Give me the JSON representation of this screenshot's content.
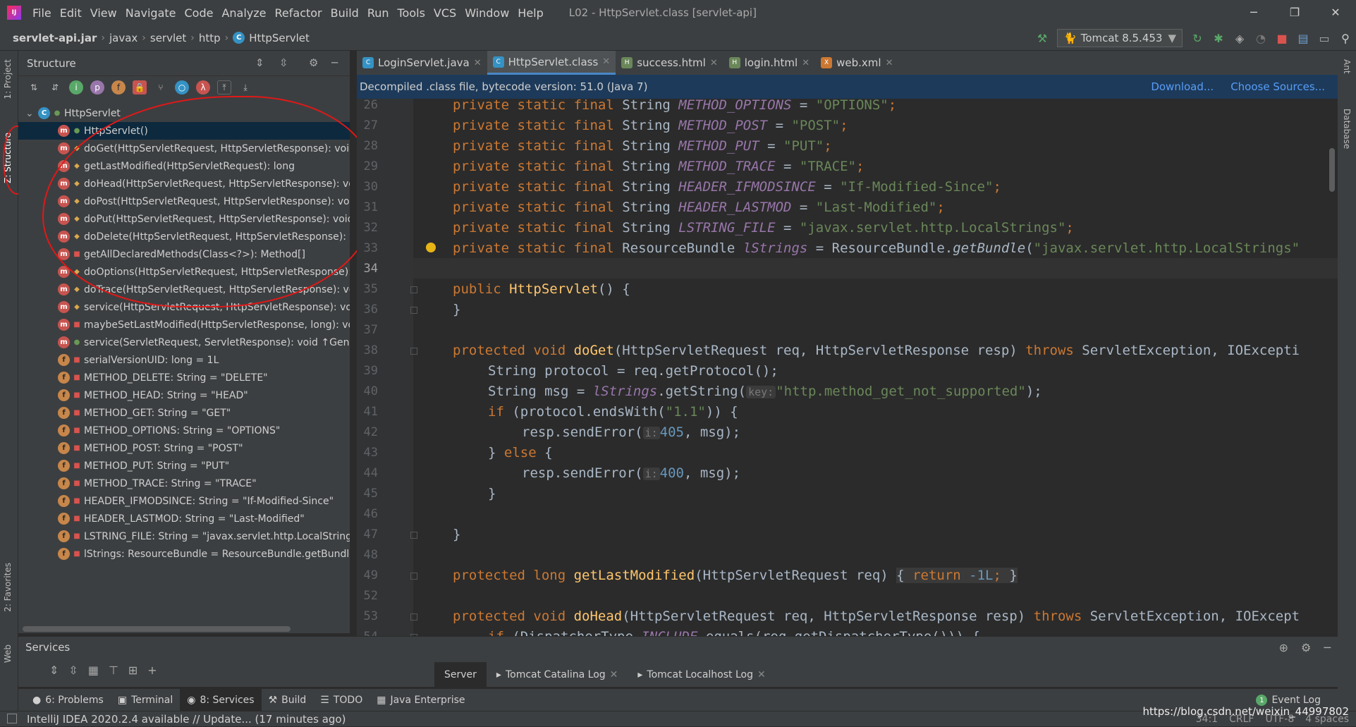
{
  "app": {
    "title": "L02 - HttpServlet.class [servlet-api]"
  },
  "menu": [
    "File",
    "Edit",
    "View",
    "Navigate",
    "Code",
    "Analyze",
    "Refactor",
    "Build",
    "Run",
    "Tools",
    "VCS",
    "Window",
    "Help"
  ],
  "window_controls": {
    "minimize": "─",
    "maximize": "❐",
    "close": "✕"
  },
  "breadcrumbs": [
    "servlet-api.jar",
    "javax",
    "servlet",
    "http",
    "HttpServlet"
  ],
  "run_config": "Tomcat 8.5.453",
  "left_strip": {
    "project": "1: Project",
    "structure": "Z: Structure",
    "favorites": "2: Favorites",
    "web": "Web"
  },
  "right_strip": {
    "ant": "Ant",
    "database": "Database"
  },
  "structure": {
    "title": "Structure",
    "root": "HttpServlet",
    "items": [
      {
        "kind": "m",
        "vis": "pub",
        "label": "HttpServlet()"
      },
      {
        "kind": "m",
        "vis": "prot",
        "label": "doGet(HttpServletRequest, HttpServletResponse): void ↑Gen"
      },
      {
        "kind": "m",
        "vis": "prot",
        "label": "getLastModified(HttpServletRequest): long"
      },
      {
        "kind": "m",
        "vis": "prot",
        "label": "doHead(HttpServletRequest, HttpServletResponse): void"
      },
      {
        "kind": "m",
        "vis": "prot",
        "label": "doPost(HttpServletRequest, HttpServletResponse): void"
      },
      {
        "kind": "m",
        "vis": "prot",
        "label": "doPut(HttpServletRequest, HttpServletResponse): void"
      },
      {
        "kind": "m",
        "vis": "prot",
        "label": "doDelete(HttpServletRequest, HttpServletResponse): void"
      },
      {
        "kind": "m",
        "vis": "priv",
        "label": "getAllDeclaredMethods(Class<?>): Method[]"
      },
      {
        "kind": "m",
        "vis": "prot",
        "label": "doOptions(HttpServletRequest, HttpServletResponse): void"
      },
      {
        "kind": "m",
        "vis": "prot",
        "label": "doTrace(HttpServletRequest, HttpServletResponse): void"
      },
      {
        "kind": "m",
        "vis": "prot",
        "label": "service(HttpServletRequest, HttpServletResponse): void"
      },
      {
        "kind": "m",
        "vis": "priv",
        "label": "maybeSetLastModified(HttpServletResponse, long): void"
      },
      {
        "kind": "m",
        "vis": "pub",
        "label": "service(ServletRequest, ServletResponse): void ↑Gen"
      },
      {
        "kind": "f",
        "vis": "priv",
        "label": "serialVersionUID: long = 1L"
      },
      {
        "kind": "f",
        "vis": "priv",
        "label": "METHOD_DELETE: String = \"DELETE\""
      },
      {
        "kind": "f",
        "vis": "priv",
        "label": "METHOD_HEAD: String = \"HEAD\""
      },
      {
        "kind": "f",
        "vis": "priv",
        "label": "METHOD_GET: String = \"GET\""
      },
      {
        "kind": "f",
        "vis": "priv",
        "label": "METHOD_OPTIONS: String = \"OPTIONS\""
      },
      {
        "kind": "f",
        "vis": "priv",
        "label": "METHOD_POST: String = \"POST\""
      },
      {
        "kind": "f",
        "vis": "priv",
        "label": "METHOD_PUT: String = \"PUT\""
      },
      {
        "kind": "f",
        "vis": "priv",
        "label": "METHOD_TRACE: String = \"TRACE\""
      },
      {
        "kind": "f",
        "vis": "priv",
        "label": "HEADER_IFMODSINCE: String = \"If-Modified-Since\""
      },
      {
        "kind": "f",
        "vis": "priv",
        "label": "HEADER_LASTMOD: String = \"Last-Modified\""
      },
      {
        "kind": "f",
        "vis": "priv",
        "label": "LSTRING_FILE: String = \"javax.servlet.http.LocalStrings\""
      },
      {
        "kind": "f",
        "vis": "priv",
        "label": "lStrings: ResourceBundle = ResourceBundle.getBundle(...)"
      }
    ]
  },
  "editor_tabs": [
    {
      "label": "LoginServlet.java",
      "type": "C",
      "color": "#3592c4",
      "active": false
    },
    {
      "label": "HttpServlet.class",
      "type": "C",
      "color": "#3592c4",
      "active": true
    },
    {
      "label": "success.html",
      "type": "H",
      "color": "#6a8759",
      "active": false
    },
    {
      "label": "login.html",
      "type": "H",
      "color": "#6a8759",
      "active": false
    },
    {
      "label": "web.xml",
      "type": "X",
      "color": "#cc7832",
      "active": false
    }
  ],
  "banner": {
    "text": "Decompiled .class file, bytecode version: 51.0 (Java 7)",
    "download": "Download...",
    "choose": "Choose Sources..."
  },
  "line_numbers": [
    "26",
    "27",
    "28",
    "29",
    "30",
    "31",
    "32",
    "33",
    "34",
    "35",
    "36",
    "37",
    "38",
    "39",
    "40",
    "41",
    "42",
    "43",
    "44",
    "45",
    "46",
    "47",
    "48",
    "49",
    "52",
    "53",
    "54"
  ],
  "code": {
    "l26": {
      "kw": "private static final ",
      "type": "String ",
      "name": "METHOD_OPTIONS",
      "eq": " = ",
      "val": "\"OPTIONS\"",
      "end": ";"
    },
    "l27": {
      "kw": "private static final ",
      "type": "String ",
      "name": "METHOD_POST",
      "eq": " = ",
      "val": "\"POST\"",
      "end": ";"
    },
    "l28": {
      "kw": "private static final ",
      "type": "String ",
      "name": "METHOD_PUT",
      "eq": " = ",
      "val": "\"PUT\"",
      "end": ";"
    },
    "l29": {
      "kw": "private static final ",
      "type": "String ",
      "name": "METHOD_TRACE",
      "eq": " = ",
      "val": "\"TRACE\"",
      "end": ";"
    },
    "l30": {
      "kw": "private static final ",
      "type": "String ",
      "name": "HEADER_IFMODSINCE",
      "eq": " = ",
      "val": "\"If-Modified-Since\"",
      "end": ";"
    },
    "l31": {
      "kw": "private static final ",
      "type": "String ",
      "name": "HEADER_LASTMOD",
      "eq": " = ",
      "val": "\"Last-Modified\"",
      "end": ";"
    },
    "l32": {
      "kw": "private static final ",
      "type": "String ",
      "name": "LSTRING_FILE",
      "eq": " = ",
      "val": "\"javax.servlet.http.LocalStrings\"",
      "end": ";"
    },
    "l33": {
      "kw": "private static final ",
      "type": "ResourceBundle ",
      "name": "lStrings",
      "eq": " = ResourceBundle.",
      "call": "getBundle",
      "open": "(",
      "val": "\"javax.servlet.http.LocalStrings\""
    },
    "l35": {
      "kw": "public ",
      "name": "HttpServlet",
      "rest": "() {"
    },
    "l36": {
      "rest": "}"
    },
    "l38": {
      "kw": "protected void ",
      "name": "doGet",
      "a": "(HttpServletRequest req, HttpServletResponse resp) ",
      "kw2": "throws ",
      "b": "ServletException, IOExcepti"
    },
    "l39": {
      "rest": "String protocol = req.getProtocol();"
    },
    "l40": {
      "a": "String msg = ",
      "sf": "lStrings",
      "b": ".getString(",
      "hint": "key:",
      "val": "\"http.method_get_not_supported\"",
      "end": ");"
    },
    "l41": {
      "kw": "if ",
      "a": "(protocol.endsWith(",
      "val": "\"1.1\"",
      "end": ")) {"
    },
    "l42": {
      "a": "resp.sendError(",
      "hint": "i:",
      "num": "405",
      "end": ", msg);"
    },
    "l43": {
      "a": "} ",
      "kw": "else ",
      "end": "{"
    },
    "l44": {
      "a": "resp.sendError(",
      "hint": "i:",
      "num": "400",
      "end": ", msg);"
    },
    "l45": {
      "rest": "}"
    },
    "l47": {
      "rest": "}"
    },
    "l49": {
      "kw": "protected long ",
      "name": "getLastModified",
      "a": "(HttpServletRequest req) ",
      "fb1": "{ ",
      "kw2": "return ",
      "num": "-1L",
      "end": ";",
      "fb2": " }"
    },
    "l53": {
      "kw": "protected void ",
      "name": "doHead",
      "a": "(HttpServletRequest req, HttpServletResponse resp) ",
      "kw2": "throws ",
      "b": "ServletException, IOExcept"
    },
    "l54": {
      "kw": "if ",
      "a": "(DispatcherType.",
      "sf": "INCLUDE",
      "b": ".equals(req.getDispatcherType())) {"
    }
  },
  "services": {
    "title": "Services",
    "tabs": [
      {
        "label": "Server",
        "active": true
      },
      {
        "label": "Tomcat Catalina Log",
        "active": false
      },
      {
        "label": "Tomcat Localhost Log",
        "active": false
      }
    ]
  },
  "bottom_tabs": [
    {
      "label": "6: Problems",
      "icon": "●",
      "active": false
    },
    {
      "label": "Terminal",
      "icon": "▣",
      "active": false
    },
    {
      "label": "8: Services",
      "icon": "◉",
      "active": true
    },
    {
      "label": "Build",
      "icon": "⚒",
      "active": false
    },
    {
      "label": "TODO",
      "icon": "☰",
      "active": false
    },
    {
      "label": "Java Enterprise",
      "icon": "▦",
      "active": false
    }
  ],
  "event_log": {
    "label": "Event Log",
    "count": "1"
  },
  "status": {
    "text": "IntelliJ IDEA 2020.2.4 available // Update... (17 minutes ago)",
    "position": "34:1",
    "separator": "CRLF",
    "encoding": "UTF-8",
    "indent": "4 spaces"
  },
  "watermark": "https://blog.csdn.net/weixin_44997802",
  "colors": {
    "accent": "#4a88c7",
    "annotation": "#e01818",
    "keyword": "#cc7832",
    "string": "#6a8759",
    "static_field": "#9876aa",
    "method": "#ffc66d",
    "number": "#6897bb"
  }
}
